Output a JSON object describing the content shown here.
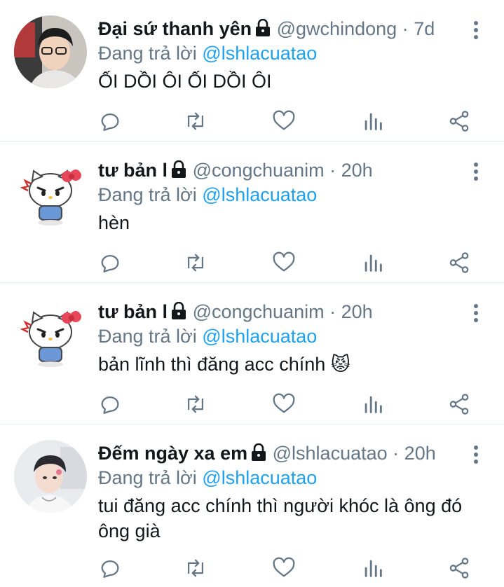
{
  "tweets": [
    {
      "name": "Đại sứ thanh yên",
      "handle": "@gwchindong",
      "dot": "·",
      "time": "7d",
      "reply_prefix": "Đang trả lời",
      "reply_to": "@lshlacuatao",
      "text": "ỐI DỒI ÔI ỐI DỒI ÔI",
      "avatar": "photo-boy-glasses"
    },
    {
      "name": "tư bản l",
      "handle": "@congchuanim",
      "dot": "·",
      "time": "20h",
      "reply_prefix": "Đang trả lời",
      "reply_to": "@lshlacuatao",
      "text": "hèn",
      "avatar": "hello-kitty-angry"
    },
    {
      "name": "tư bản l",
      "handle": "@congchuanim",
      "dot": "·",
      "time": "20h",
      "reply_prefix": "Đang trả lời",
      "reply_to": "@lshlacuatao",
      "text": "bản lĩnh thì đăng acc chính 😾",
      "avatar": "hello-kitty-angry"
    },
    {
      "name": "Đếm ngày xa em",
      "handle": "@lshlacuatao",
      "dot": "·",
      "time": "20h",
      "reply_prefix": "Đang trả lời",
      "reply_to": "@lshlacuatao",
      "text": "tui đăng acc chính thì người khóc là ông đó ông già",
      "avatar": "photo-boy-light"
    }
  ],
  "icons": {
    "reply": "reply-icon",
    "retweet": "retweet-icon",
    "like": "heart-icon",
    "stats": "analytics-icon",
    "share": "share-icon",
    "more": "more-vertical-icon",
    "lock": "lock-icon"
  },
  "colors": {
    "text": "#14171a",
    "secondary": "#657786",
    "link": "#1da1f2",
    "divider": "#e6ecf0"
  }
}
